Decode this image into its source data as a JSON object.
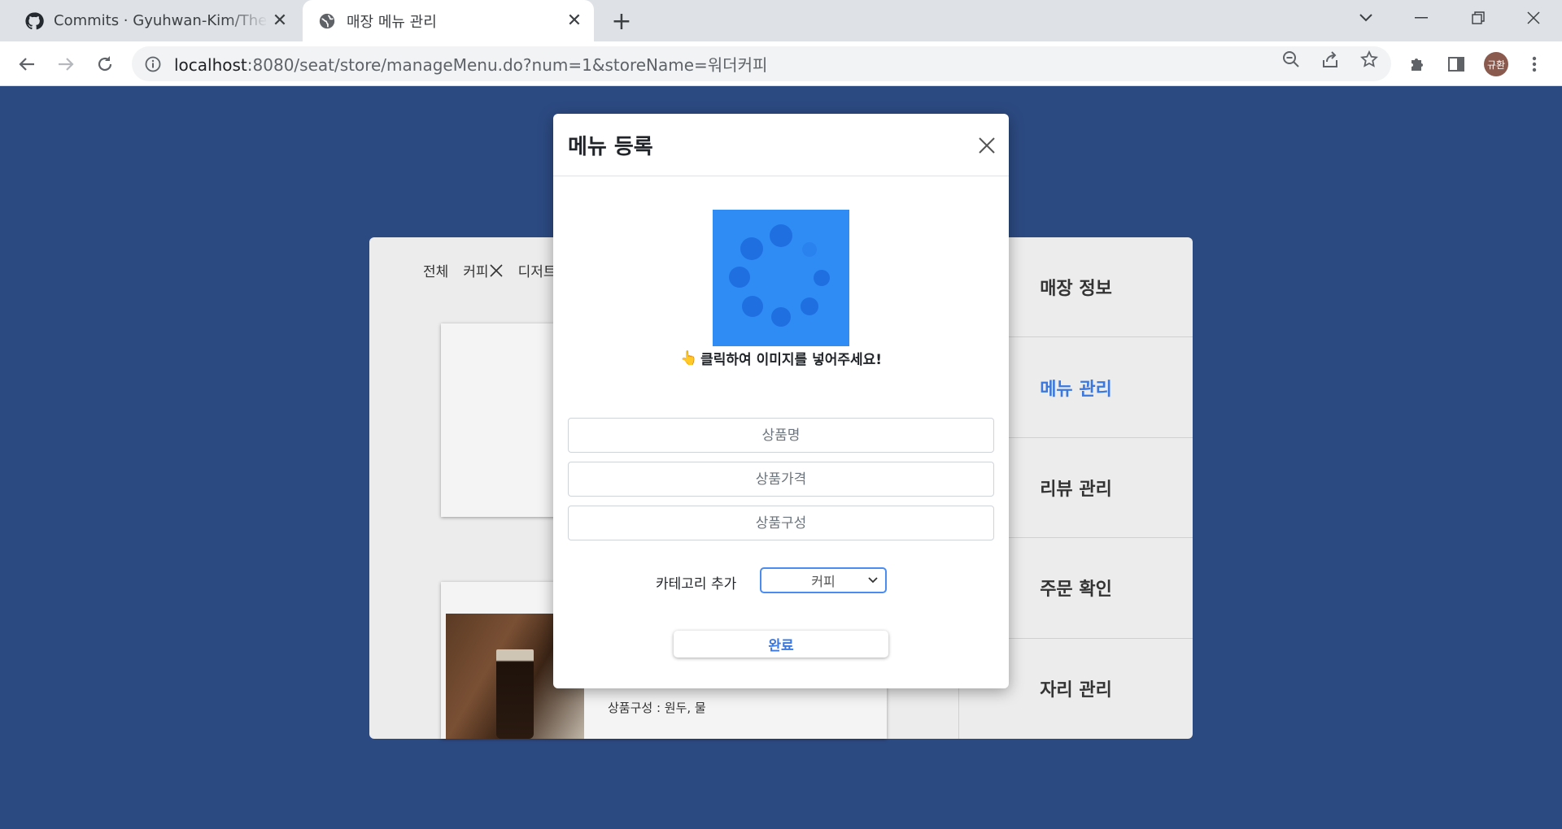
{
  "browser": {
    "tabs": [
      {
        "title": "Commits · Gyuhwan-Kim/TheSeat",
        "icon": "github-icon"
      },
      {
        "title": "매장 메뉴 관리",
        "icon": "globe-icon"
      }
    ],
    "url": {
      "host": "localhost",
      "rest": ":8080/seat/store/manageMenu.do?num=1&storeName=워더커피"
    },
    "profile_initials": "규환"
  },
  "page": {
    "categories": [
      "전체",
      "커피",
      "디저트"
    ],
    "card2_desc": "상품구성 : 원두, 물",
    "sidebar": [
      {
        "label": "매장 정보",
        "active": false
      },
      {
        "label": "메뉴 관리",
        "active": true
      },
      {
        "label": "리뷰 관리",
        "active": false
      },
      {
        "label": "주문 확인",
        "active": false
      },
      {
        "label": "자리 관리",
        "active": false
      }
    ]
  },
  "modal": {
    "title": "메뉴 등록",
    "upload_hint": "클릭하여 이미지를 넣어주세요!",
    "upload_hint_icon": "👆",
    "placeholders": {
      "name": "상품명",
      "price": "상품가격",
      "composition": "상품구성"
    },
    "category_label": "카테고리 추가",
    "category_selected": "커피",
    "submit_label": "완료"
  },
  "colors": {
    "page_bg": "#2c4a82",
    "accent": "#3a78e0",
    "upload_bg": "#2f8cf5"
  }
}
